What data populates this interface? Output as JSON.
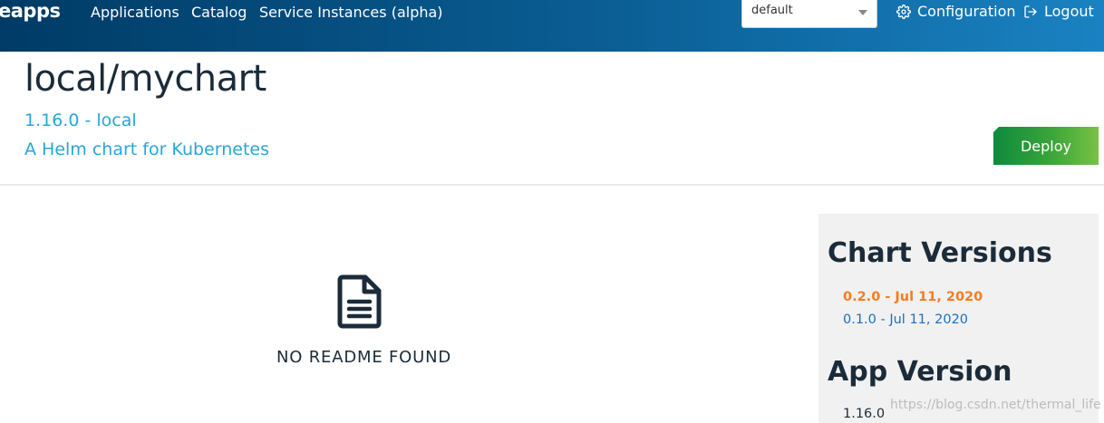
{
  "header": {
    "brand": "eapps",
    "nav": [
      {
        "label": "Applications"
      },
      {
        "label": "Catalog"
      },
      {
        "label": "Service Instances (alpha)"
      }
    ],
    "namespace_select": {
      "value": "default"
    },
    "configuration_label": "Configuration",
    "logout_label": "Logout"
  },
  "chart": {
    "title": "local/mychart",
    "version_line": "1.16.0 - local",
    "description": "A Helm chart for Kubernetes",
    "deploy_label": "Deploy"
  },
  "readme": {
    "empty_text": "NO README FOUND",
    "icon": "file-text-icon"
  },
  "sidebar": {
    "chart_versions_title": "Chart Versions",
    "versions": [
      {
        "label": "0.2.0 - Jul 11, 2020",
        "active": true
      },
      {
        "label": "0.1.0 - Jul 11, 2020",
        "active": false
      }
    ],
    "app_version_title": "App Version",
    "app_version": "1.16.0"
  },
  "watermark": "https://blog.csdn.net/thermal_life",
  "colors": {
    "header_start": "#003b66",
    "header_end": "#1a82c2",
    "link": "#27a6d6",
    "active_version": "#f57c21",
    "version_link": "#1a6fbf",
    "deploy_start": "#0f8a3c",
    "deploy_end": "#79c143"
  }
}
